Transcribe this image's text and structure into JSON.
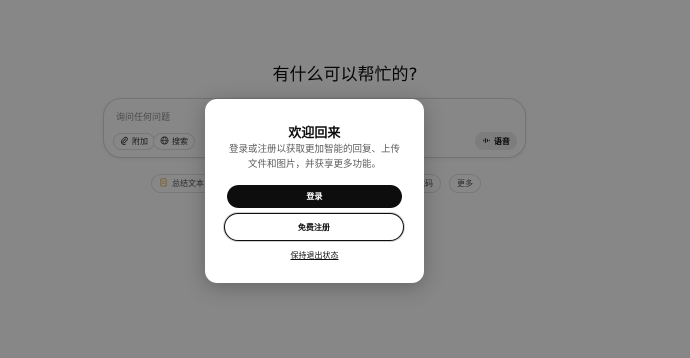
{
  "main": {
    "heading": "有什么可以帮忙的?",
    "composer": {
      "placeholder": "询问任何问题",
      "attach_label": "附加",
      "search_label": "搜索",
      "voice_label": "语音"
    },
    "suggestions": [
      {
        "label": "总结文本",
        "icon": "document-icon"
      },
      {
        "label": "代码",
        "icon": "code-icon"
      },
      {
        "label": "更多",
        "icon": ""
      }
    ]
  },
  "modal": {
    "title": "欢迎回来",
    "description": "登录或注册以获取更加智能的回复、上传文件和图片，并获享更多功能。",
    "login_label": "登录",
    "signup_label": "免费注册",
    "stay_logged_out_label": "保持退出状态"
  },
  "colors": {
    "overlay": "#000000",
    "primary_button": "#0d0d0d",
    "modal_background": "#ffffff"
  }
}
